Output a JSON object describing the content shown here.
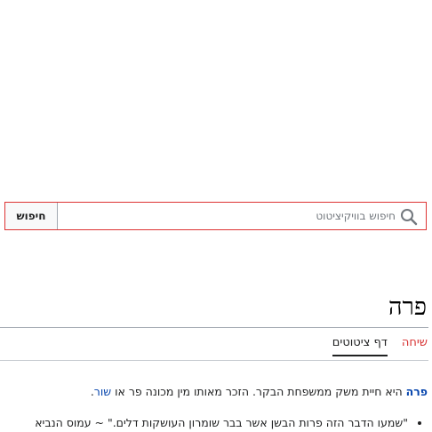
{
  "search": {
    "button_label": "חיפוש",
    "placeholder": "חיפוש בוויקיציטוט"
  },
  "page": {
    "title": "פרה"
  },
  "tabs": [
    {
      "label": "דף ציטוטים"
    },
    {
      "label": "שיחה"
    }
  ],
  "content": {
    "intro": {
      "term": "פרה",
      "text": " היא חיית משק ממשפחת הבקר. הזכר מאותו מין מכונה פר או ",
      "link": "שור",
      "end": "."
    },
    "quotes": [
      {
        "text": "\"שמעו הדבר הזה פרות הבשן אשר בבר שומרון העושקות דלים.\" ~ עמוס הנביא"
      }
    ]
  },
  "colors": {
    "link": "#0645ad",
    "new_link": "#d73333",
    "search_border": "#dd3333"
  }
}
